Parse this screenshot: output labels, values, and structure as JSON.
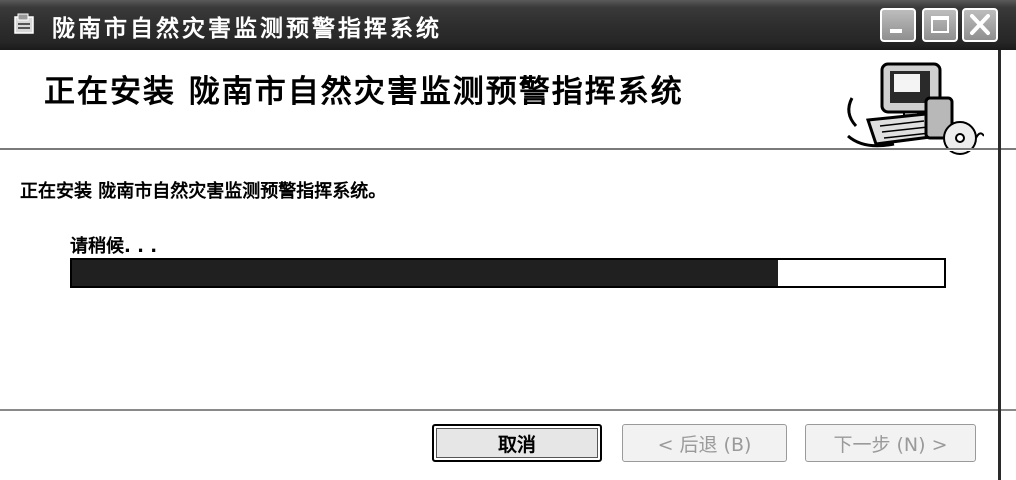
{
  "window": {
    "title": "陇南市自然灾害监测预警指挥系统",
    "controls": [
      "minimize-icon",
      "maximize-icon",
      "close-icon"
    ]
  },
  "header": {
    "title": "正在安装  陇南市自然灾害监测预警指挥系统",
    "graphic_icon": "computer-install-icon"
  },
  "body": {
    "status": "正在安装 陇南市自然灾害监测预警指挥系统。",
    "wait_label": "请稍候. . .",
    "progress": 0.81
  },
  "buttons": {
    "cancel": "取消",
    "back": "< 后退 (B)",
    "next": "下一步 (N) >"
  }
}
